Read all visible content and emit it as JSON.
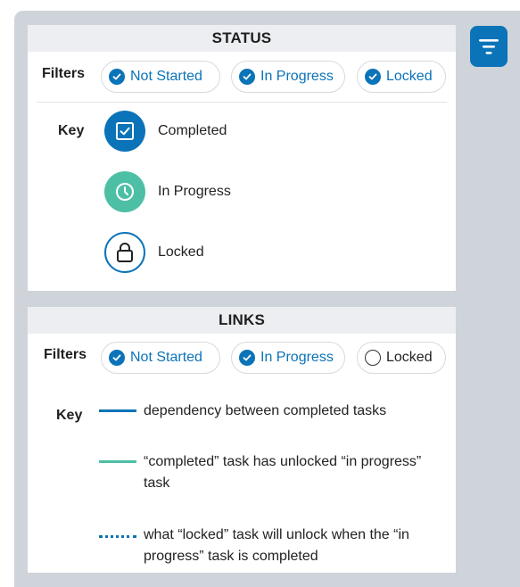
{
  "status": {
    "title": "STATUS",
    "filters_label": "Filters",
    "filters": [
      {
        "label": "Not Started",
        "checked": true
      },
      {
        "label": "In Progress",
        "checked": true
      },
      {
        "label": "Locked",
        "checked": true
      }
    ],
    "key_label": "Key",
    "key": [
      {
        "label": "Completed",
        "icon": "check-square-icon",
        "color": "#0b73b8"
      },
      {
        "label": "In Progress",
        "icon": "clock-icon",
        "color": "#4dbfa5"
      },
      {
        "label": "Locked",
        "icon": "lock-icon",
        "color": "#0b73b8"
      }
    ]
  },
  "links": {
    "title": "LINKS",
    "filters_label": "Filters",
    "filters": [
      {
        "label": "Not Started",
        "checked": true
      },
      {
        "label": "In Progress",
        "checked": true
      },
      {
        "label": "Locked",
        "checked": false
      }
    ],
    "key_label": "Key",
    "key": [
      {
        "label": "dependency between completed tasks",
        "style": "solid",
        "color": "#0b73b8"
      },
      {
        "label": "“completed” task has unlocked “in progress” task",
        "style": "solid",
        "color": "#4dbfa5"
      },
      {
        "label": "what “locked” task will unlock when the “in progress” task is completed",
        "style": "dotted",
        "color": "#0b73b8"
      }
    ]
  },
  "toolbar": {
    "filter_icon": "filter-icon"
  },
  "colors": {
    "accent": "#0b73b8",
    "teal": "#4dbfa5",
    "panel_bg": "#cfd3da"
  }
}
